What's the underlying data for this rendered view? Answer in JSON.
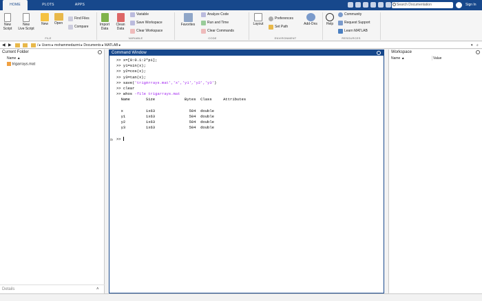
{
  "tabs": [
    "HOME",
    "PLOTS",
    "APPS"
  ],
  "search": {
    "placeholder": "Search Documentation"
  },
  "signin": "Sign In",
  "ribbon": {
    "file": {
      "label": "FILE",
      "new_script": [
        "New",
        "Script"
      ],
      "new_live_script": [
        "New",
        "Live Script"
      ],
      "new": "New",
      "open": "Open",
      "find_files": "Find Files",
      "compare": "Compare"
    },
    "variable": {
      "label": "VARIABLE",
      "import_data": [
        "Import",
        "Data"
      ],
      "clean_data": [
        "Clean",
        "Data"
      ],
      "variable": "Variable",
      "save_workspace": "Save Workspace",
      "clear_workspace": "Clear Workspace"
    },
    "code": {
      "label": "CODE",
      "favorites": "Favorites",
      "analyze_code": "Analyze Code",
      "run_and_time": "Run and Time",
      "clear_commands": "Clear Commands"
    },
    "environment": {
      "label": "ENVIRONMENT",
      "layout": "Layout",
      "preferences": "Preferences",
      "set_path": "Set Path",
      "add_ons": "Add-Ons"
    },
    "resources": {
      "label": "RESOURCES",
      "help": "Help",
      "community": "Community",
      "request_support": "Request Support",
      "learn_matlab": "Learn MATLAB"
    }
  },
  "address": {
    "sep0": "/",
    "p1": "Users",
    "p2": "mohammedazmi",
    "p3": "Documents",
    "p4": "MATLAB"
  },
  "current_folder": {
    "title": "Current Folder",
    "col_name": "Name",
    "sort_arrow": "▲",
    "file": "trigarrays.mat",
    "details": "Details"
  },
  "command_window": {
    "title": "Command Window",
    "lines": [
      {
        "p": ">> ",
        "t": "x=[0:0.1:2*pi];"
      },
      {
        "p": ">> ",
        "t": "y1=sin(x);"
      },
      {
        "p": ">> ",
        "t": "y2=cos(x);"
      },
      {
        "p": ">> ",
        "t": "y3=tan(x);"
      },
      {
        "p": ">> ",
        "t": "save(",
        "s": "'trigArrays.mat','x','y1','y2','y3'",
        "e": ")"
      },
      {
        "p": ">> ",
        "t": "clear"
      },
      {
        "p": ">> ",
        "t": "whos ",
        "s": "-file trigarrays.mat",
        "e": ""
      }
    ],
    "headers": "  Name       Size             Bytes  Class     Attributes",
    "rows": [
      "  x          1x63               504  double",
      "  y1         1x63               504  double",
      "  y2         1x63               504  double",
      "  y3         1x63               504  double"
    ],
    "fx": "fx",
    "prompt": ">> "
  },
  "workspace": {
    "title": "Workspace",
    "col_name": "Name",
    "col_value": "Value",
    "sort_arrow": "▲"
  }
}
